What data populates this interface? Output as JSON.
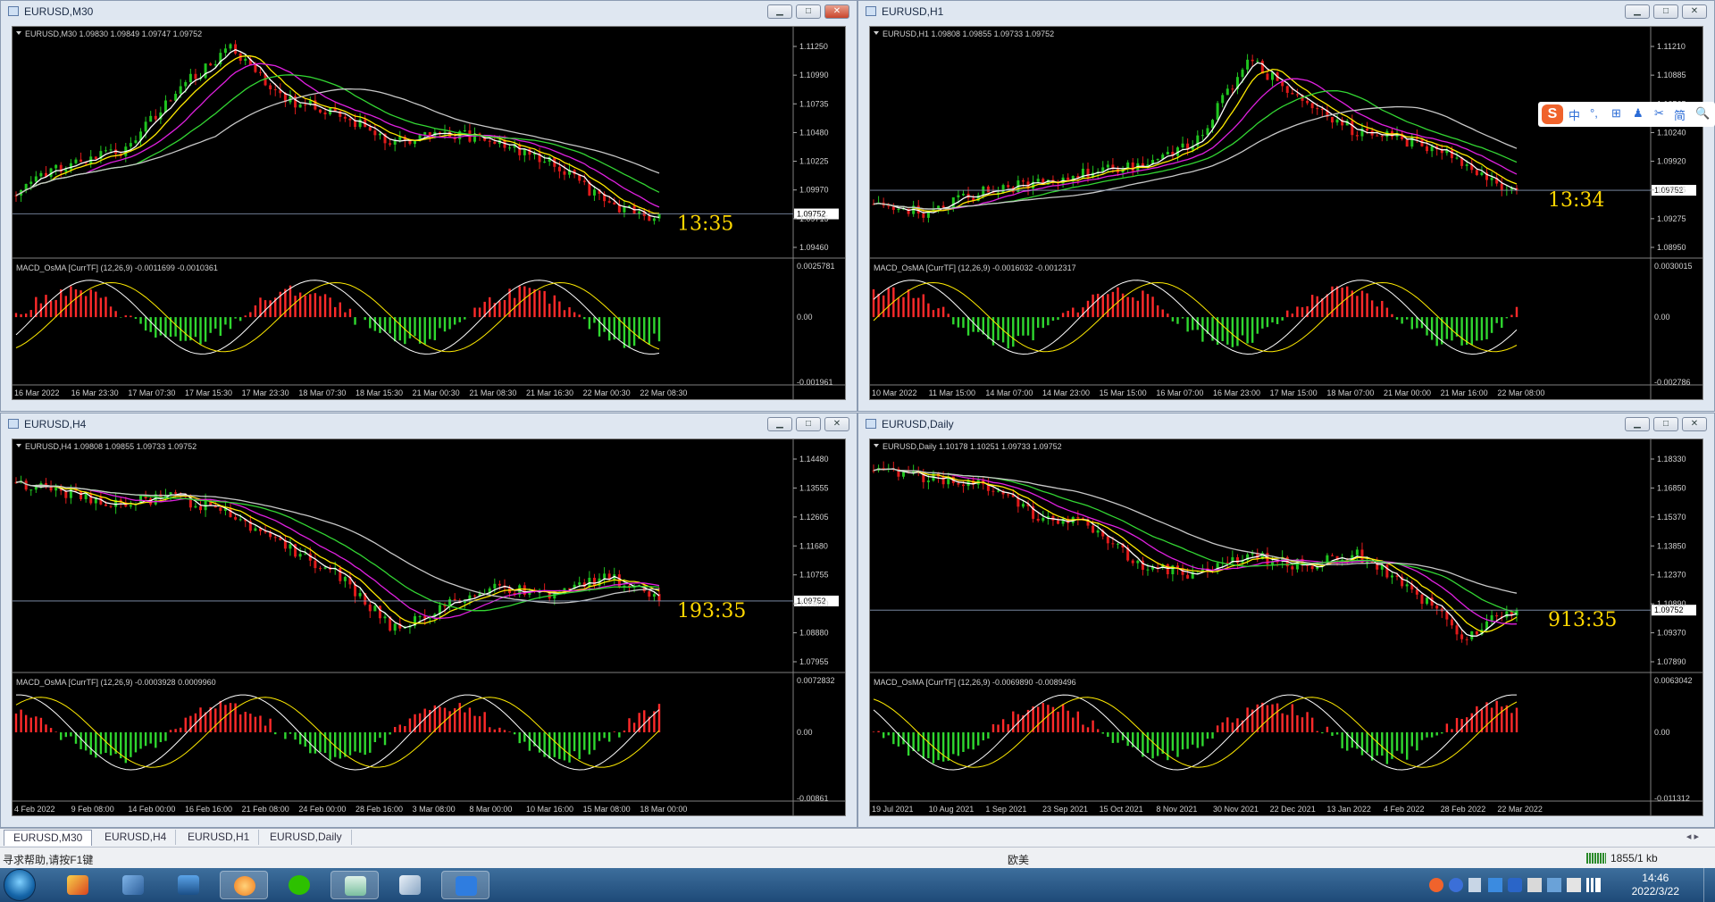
{
  "colors": {
    "bull": "#1fc51f",
    "bear": "#e11a1a",
    "ma_white": "#ffffff",
    "ma_yellow": "#ffeb00",
    "ma_magenta": "#e020e0",
    "ma_green": "#33d633",
    "ma_gray": "#c8c8c8",
    "macd_up": "#ff2a2a",
    "macd_down": "#2fd72f"
  },
  "windows": [
    {
      "title": "EURUSD,M30",
      "main_label": "EURUSD,M30  1.09830 1.09849 1.09747 1.09752",
      "price_ticks": [
        "1.11250",
        "1.10990",
        "1.10735",
        "1.10480",
        "1.10225",
        "1.09970",
        "1.09715",
        "1.09460"
      ],
      "price_tag": "1.09752",
      "countdown": "13:35",
      "macd_label": "MACD_OsMA [CurrTF] (12,26,9) -0.0011699 -0.0010361",
      "macd_ticks": [
        "0.0025781",
        "0.00",
        "-0.001961"
      ],
      "time_labels": [
        "16 Mar 2022",
        "16 Mar 23:30",
        "17 Mar 07:30",
        "17 Mar 15:30",
        "17 Mar 23:30",
        "18 Mar 07:30",
        "18 Mar 15:30",
        "21 Mar 00:30",
        "21 Mar 08:30",
        "21 Mar 16:30",
        "22 Mar 00:30",
        "22 Mar 08:30"
      ],
      "buttons": [
        "▁",
        "□",
        "✕"
      ]
    },
    {
      "title": "EURUSD,H1",
      "main_label": "EURUSD,H1  1.09808 1.09855 1.09733 1.09752",
      "price_ticks": [
        "1.11210",
        "1.10885",
        "1.10565",
        "1.10240",
        "1.09920",
        "1.09595",
        "1.09275",
        "1.08950"
      ],
      "price_tag": "1.09752",
      "countdown": "13:34",
      "macd_label": "MACD_OsMA [CurrTF] (12,26,9) -0.0016032 -0.0012317",
      "macd_ticks": [
        "0.0030015",
        "0.00",
        "-0.002786"
      ],
      "time_labels": [
        "10 Mar 2022",
        "11 Mar 15:00",
        "14 Mar 07:00",
        "14 Mar 23:00",
        "15 Mar 15:00",
        "16 Mar 07:00",
        "16 Mar 23:00",
        "17 Mar 15:00",
        "18 Mar 07:00",
        "21 Mar 00:00",
        "21 Mar 16:00",
        "22 Mar 08:00"
      ],
      "buttons": [
        "▁",
        "□",
        "✕"
      ]
    },
    {
      "title": "EURUSD,H4",
      "main_label": "EURUSD,H4  1.09808 1.09855 1.09733 1.09752",
      "price_ticks": [
        "1.14480",
        "1.13555",
        "1.12605",
        "1.11680",
        "1.10755",
        "1.09830",
        "1.08880",
        "1.07955"
      ],
      "price_tag": "1.09752",
      "countdown": "193:35",
      "macd_label": "MACD_OsMA [CurrTF] (12,26,9) -0.0003928 0.0009960",
      "macd_ticks": [
        "0.0072832",
        "0.00",
        "-0.00861"
      ],
      "time_labels": [
        "4 Feb 2022",
        "9 Feb 08:00",
        "14 Feb 00:00",
        "16 Feb 16:00",
        "21 Feb 08:00",
        "24 Feb 00:00",
        "28 Feb 16:00",
        "3 Mar 08:00",
        "8 Mar 00:00",
        "10 Mar 16:00",
        "15 Mar 08:00",
        "18 Mar 00:00"
      ],
      "buttons": [
        "▁",
        "□",
        "✕"
      ]
    },
    {
      "title": "EURUSD,Daily",
      "main_label": "EURUSD,Daily  1.10178 1.10251 1.09733 1.09752",
      "price_ticks": [
        "1.18330",
        "1.16850",
        "1.15370",
        "1.13850",
        "1.12370",
        "1.10890",
        "1.09370",
        "1.07890"
      ],
      "price_tag": "1.09752",
      "countdown": "913:35",
      "macd_label": "MACD_OsMA [CurrTF] (12,26,9) -0.0069890 -0.0089496",
      "macd_ticks": [
        "0.0063042",
        "0.00",
        "-0.011312"
      ],
      "time_labels": [
        "19 Jul 2021",
        "10 Aug 2021",
        "1 Sep 2021",
        "23 Sep 2021",
        "15 Oct 2021",
        "8 Nov 2021",
        "30 Nov 2021",
        "22 Dec 2021",
        "13 Jan 2022",
        "4 Feb 2022",
        "28 Feb 2022",
        "22 Mar 2022"
      ],
      "buttons": [
        "▁",
        "□",
        "✕"
      ]
    }
  ],
  "tabs": [
    "EURUSD,M30",
    "EURUSD,H4",
    "EURUSD,H1",
    "EURUSD,Daily"
  ],
  "status": {
    "help": "寻求帮助,请按F1键",
    "profile": "欧美",
    "traffic": "1855/1 kb"
  },
  "ime": {
    "items": [
      "中",
      "°,",
      "⊞",
      "♟",
      "✂",
      "简",
      "🔍"
    ]
  },
  "clock": {
    "time": "14:46",
    "date": "2022/3/22"
  }
}
